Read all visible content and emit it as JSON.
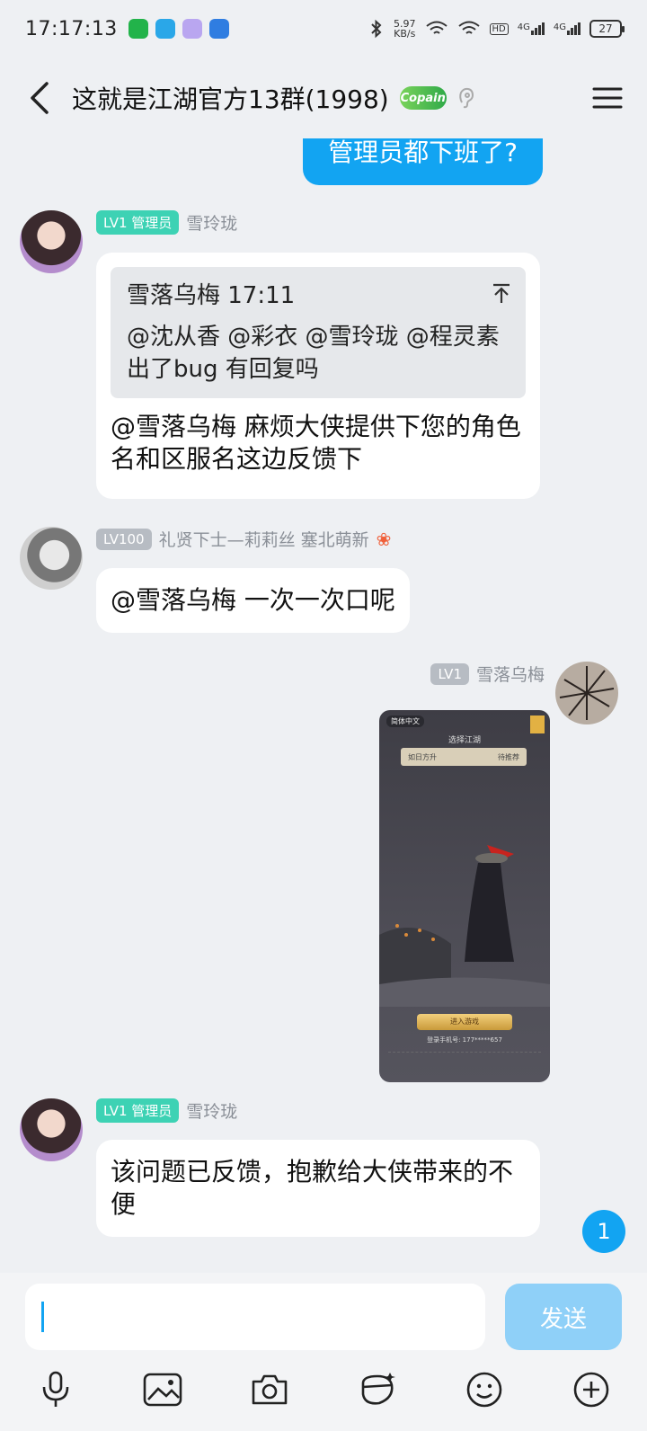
{
  "status_bar": {
    "time": "17:17:13",
    "speed_value": "5.97",
    "speed_unit": "KB/s",
    "hd1": "HD",
    "net1": "4G",
    "net2": "4G",
    "battery": "27"
  },
  "header": {
    "title": "这就是江湖官方13群(1998)",
    "badge": "Copain"
  },
  "messages": {
    "top_outgoing": "管理员都下班了?",
    "msg1": {
      "level": "LV1 管理员",
      "name": "雪玲珑",
      "quote_head": "雪落乌梅 17:11",
      "quote_body": "@沈从香 @彩衣 @雪玲珑 @程灵素   出了bug  有回复吗",
      "text": "@雪落乌梅  麻烦大侠提供下您的角色名和区服名这边反馈下"
    },
    "msg2": {
      "level": "LV100",
      "name": "礼贤下士—莉莉丝 塞北萌新",
      "text": "@雪落乌梅 一次一次口呢"
    },
    "msg3": {
      "level": "LV1",
      "name": "雪落乌梅",
      "shot_lang": "简体中文",
      "shot_title": "选择江湖",
      "shot_server": "如日方升",
      "shot_server_status": "待推荐",
      "shot_enter": "进入游戏",
      "shot_phone": "登录手机号: 177*****657"
    },
    "msg4": {
      "level": "LV1 管理员",
      "name": "雪玲珑",
      "text": "该问题已反馈，抱歉给大侠带来的不便"
    }
  },
  "unread_count": "1",
  "input": {
    "value": "",
    "send_label": "发送"
  },
  "toolbar_icons": [
    "microphone-icon",
    "image-icon",
    "camera-icon",
    "sticker-icon",
    "emoji-icon",
    "plus-icon"
  ],
  "colors": {
    "accent": "#12a4f2",
    "send_disabled": "#8fd0f8",
    "level_admin": "#3dd2b4",
    "level_gray": "#b7bcc3"
  }
}
